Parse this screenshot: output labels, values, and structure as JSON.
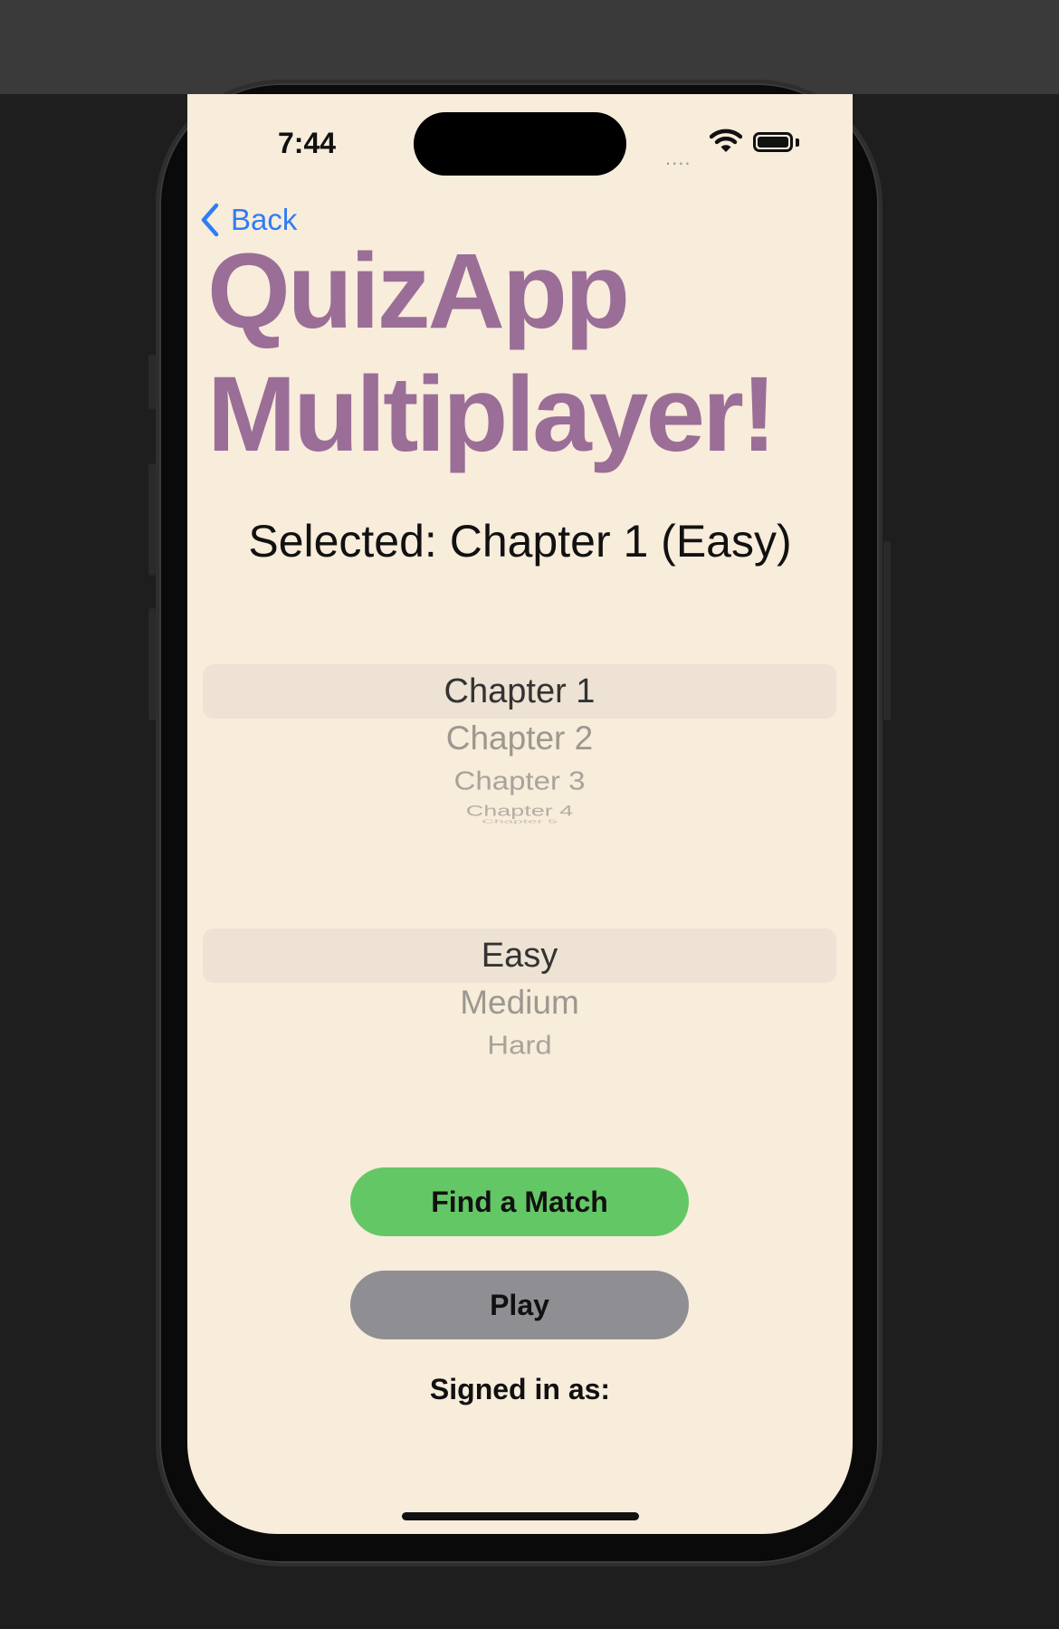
{
  "status_bar": {
    "time": "7:44",
    "signal_dots": "....",
    "wifi_icon": "wifi-icon",
    "battery_icon": "battery-icon"
  },
  "nav": {
    "back_label": "Back"
  },
  "header": {
    "title_line1": "QuizApp",
    "title_line2": "Multiplayer!"
  },
  "selection_text": "Selected: Chapter 1 (Easy)",
  "chapter_picker": {
    "selected": "Chapter 1",
    "items": [
      "Chapter 1",
      "Chapter 2",
      "Chapter 3",
      "Chapter 4",
      "Chapter 5"
    ]
  },
  "difficulty_picker": {
    "selected": "Easy",
    "items": [
      "Easy",
      "Medium",
      "Hard"
    ]
  },
  "buttons": {
    "find_match": "Find a Match",
    "play": "Play"
  },
  "signed_in_label": "Signed in as:",
  "colors": {
    "background": "#f8ecdb",
    "title": "#9a6e97",
    "find_match": "#64c766",
    "play": "#8e8e93",
    "link": "#2f7df6"
  }
}
